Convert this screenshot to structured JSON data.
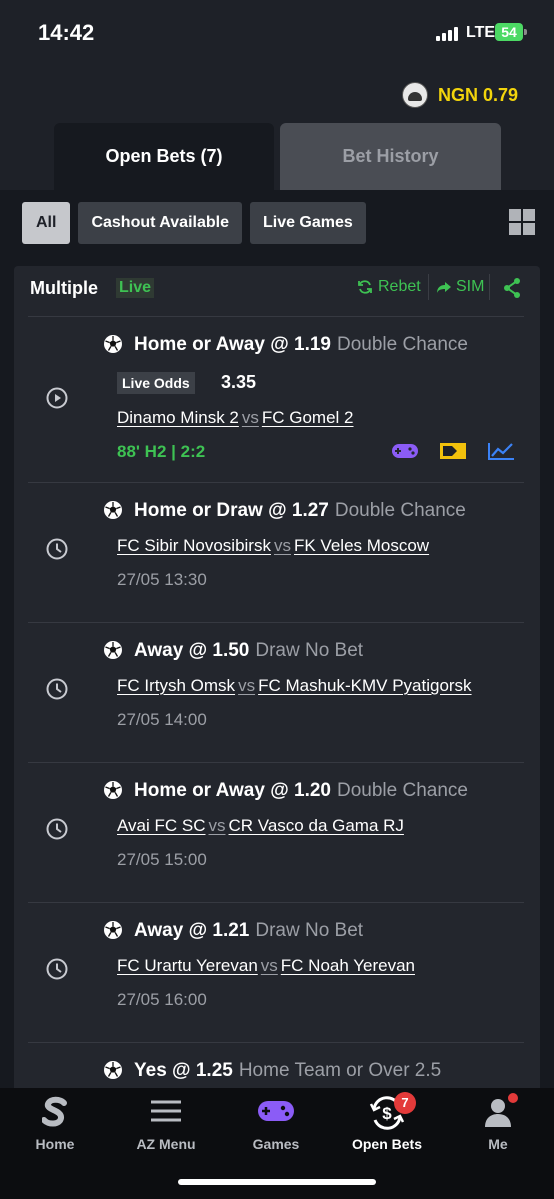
{
  "status_bar": {
    "time": "14:42",
    "network": "LTE",
    "battery": "54"
  },
  "header": {
    "balance": "NGN 0.79"
  },
  "tabs": {
    "open_bets": "Open Bets (7)",
    "bet_history": "Bet History"
  },
  "filters": {
    "all": "All",
    "cashout": "Cashout Available",
    "live_games": "Live Games"
  },
  "bet": {
    "title": "Multiple",
    "live_label": "Live",
    "rebet": "Rebet",
    "sim": "SIM",
    "selections": [
      {
        "pick": "Home or Away @ 1.19",
        "market": "Double Chance",
        "live_odds_label": "Live Odds",
        "live_odds": "3.35",
        "home": "Dinamo Minsk 2",
        "vs": "vs",
        "away": "FC Gomel 2",
        "minute": "88' H2 |",
        "score": "2:2"
      },
      {
        "pick": "Home or Draw @ 1.27",
        "market": "Double Chance",
        "home": "FC Sibir Novosibirsk",
        "vs": "vs",
        "away": "FK Veles Moscow",
        "date": "27/05 13:30"
      },
      {
        "pick": "Away @ 1.50",
        "market": "Draw No Bet",
        "home": "FC Irtysh Omsk",
        "vs": "vs",
        "away": "FC Mashuk-KMV Pyatigorsk",
        "date": "27/05 14:00"
      },
      {
        "pick": "Home or Away @ 1.20",
        "market": "Double Chance",
        "home": "Avai FC SC",
        "vs": "vs",
        "away": "CR Vasco da Gama RJ",
        "date": "27/05 15:00"
      },
      {
        "pick": "Away @ 1.21",
        "market": "Draw No Bet",
        "home": "FC Urartu Yerevan",
        "vs": "vs",
        "away": "FC Noah Yerevan",
        "date": "27/05 16:00"
      },
      {
        "pick": "Yes @ 1.25",
        "market": "Home Team or Over 2.5"
      }
    ]
  },
  "nav": {
    "home": "Home",
    "az_menu": "AZ Menu",
    "games": "Games",
    "open_bets": "Open Bets",
    "open_bets_badge": "7",
    "me": "Me"
  },
  "colors": {
    "accent_green": "#3ec253",
    "balance_yellow": "#f2d40c",
    "badge_red": "#e33a3a",
    "background": "#1e2128"
  }
}
